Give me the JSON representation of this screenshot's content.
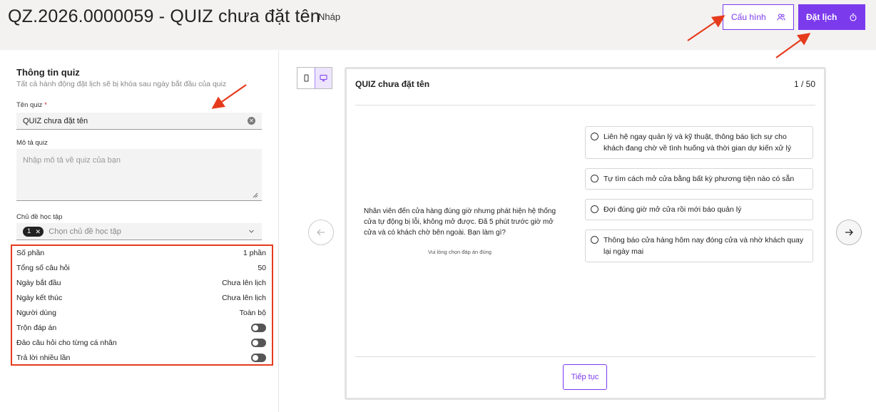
{
  "header": {
    "title": "QZ.2026.0000059 - QUIZ chưa đặt tên",
    "status": "Nháp",
    "config_label": "Cấu hình",
    "schedule_label": "Đặt lịch"
  },
  "info": {
    "title": "Thông tin quiz",
    "subtitle": "Tất cả hành động đặt lịch sẽ bị khóa sau ngày bắt đầu của quiz",
    "name_label": "Tên quiz",
    "name_required": "*",
    "name_value": "QUIZ chưa đặt tên",
    "desc_label": "Mô tả quiz",
    "desc_placeholder": "Nhập mô tả về quiz của bạn",
    "topic_label": "Chủ đề học tập",
    "topic_count": "1",
    "topic_placeholder": "Chọn chủ đề học tập"
  },
  "stats": [
    {
      "label": "Số phần",
      "value": "1 phần"
    },
    {
      "label": "Tổng số câu hỏi",
      "value": "50"
    },
    {
      "label": "Ngày bắt đầu",
      "value": "Chưa lên lịch"
    },
    {
      "label": "Ngày kết thúc",
      "value": "Chưa lên lịch"
    },
    {
      "label": "Người dùng",
      "value": "Toàn bộ"
    }
  ],
  "toggles": [
    {
      "label": "Trộn đáp án",
      "on": false
    },
    {
      "label": "Đảo câu hỏi cho từng cá nhân",
      "on": false
    },
    {
      "label": "Trả lời nhiều lần",
      "on": false
    }
  ],
  "preview": {
    "title": "QUIZ chưa đặt tên",
    "counter": "1 / 50",
    "question": "Nhân viên đến cửa hàng đúng giờ nhưng phát hiện hệ thống cửa tự động bị lỗi, không mở được. Đã 5 phút trước giờ mở cửa và có khách chờ bên ngoài. Bạn làm gì?",
    "hint": "Vui lòng chọn đáp án đúng",
    "answers": [
      "Liên hệ ngay quản lý và kỹ thuật, thông báo lịch sự cho khách đang chờ về tình huống và thời gian dự kiến xử lý",
      "Tự tìm cách mở cửa bằng bất kỳ phương tiện nào có sẵn",
      "Đợi đúng giờ mở cửa rồi mới báo quản lý",
      "Thông báo cửa hàng hôm nay đóng cửa và nhờ khách quay lại ngày mai"
    ],
    "continue_label": "Tiếp tục"
  },
  "colors": {
    "accent": "#7c3aed",
    "highlight": "#e53b1c",
    "header_bg": "#f4f1f1"
  }
}
